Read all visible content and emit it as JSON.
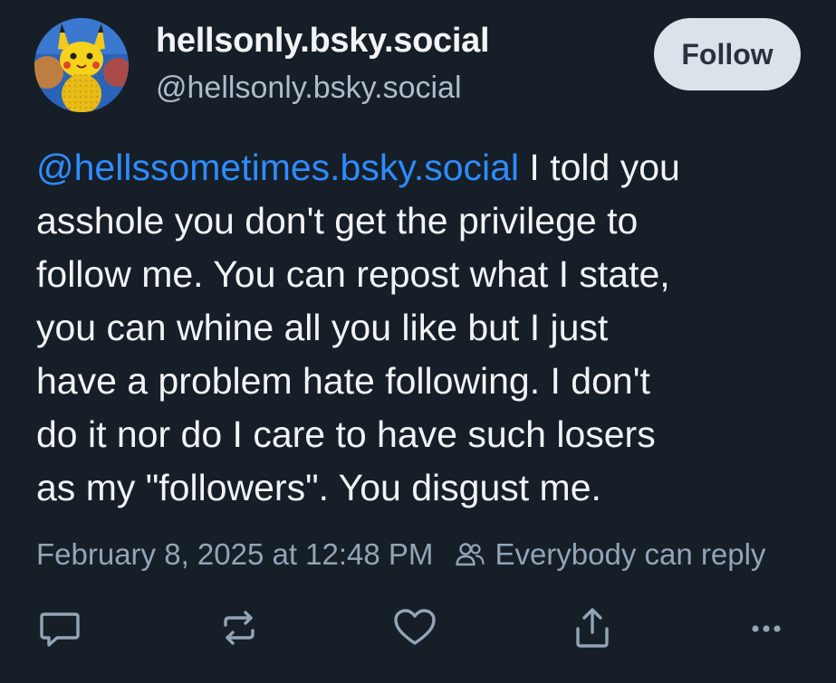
{
  "author": {
    "display_name": "hellsonly.bsky.social",
    "handle": "@hellsonly.bsky.social",
    "avatar_icon": "pikachu-avatar"
  },
  "follow_button": {
    "label": "Follow"
  },
  "post": {
    "mention": "@hellssometimes.bsky.social",
    "text": " I told you\nasshole you don't get the privilege to\nfollow me. You can repost what I state,\nyou can whine all you like but I just\nhave a problem hate following. I don't\ndo it nor do I care to have such losers\nas my \"followers\". You disgust me."
  },
  "meta": {
    "timestamp": "February 8, 2025 at 12:48 PM",
    "reply_setting": "Everybody can reply"
  },
  "actions": [
    {
      "icon": "reply-icon"
    },
    {
      "icon": "repost-icon"
    },
    {
      "icon": "like-icon"
    },
    {
      "icon": "share-icon"
    },
    {
      "icon": "more-icon"
    }
  ],
  "colors": {
    "background": "#161e27",
    "accent": "#2d8cff",
    "muted": "#93a4b7",
    "text": "#f1f3f5",
    "follow_bg": "#dce2ea"
  }
}
